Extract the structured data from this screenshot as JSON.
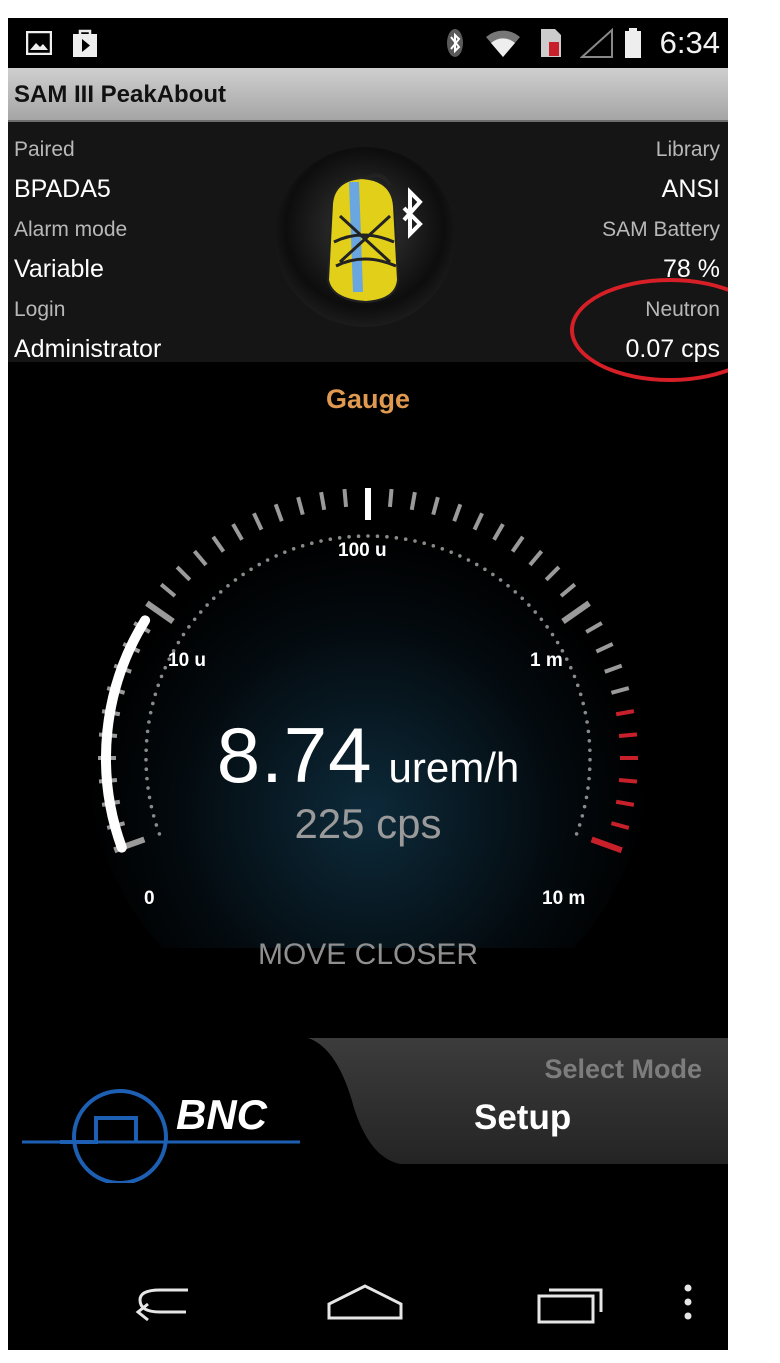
{
  "status_bar": {
    "time": "6:34",
    "icons": [
      "gallery-icon",
      "play-store-icon",
      "bluetooth-icon",
      "wifi-icon",
      "sim-icon",
      "signal-icon",
      "battery-icon"
    ]
  },
  "app": {
    "title": "SAM III PeakAbout"
  },
  "info": {
    "paired_label": "Paired",
    "paired_value": "BPADA5",
    "alarm_label": "Alarm mode",
    "alarm_value": "Variable",
    "login_label": "Login",
    "login_value": "Administrator",
    "library_label": "Library",
    "library_value": "ANSI",
    "battery_label": "SAM Battery",
    "battery_value": "78 %",
    "neutron_label": "Neutron",
    "neutron_value": "0.07 cps"
  },
  "gauge": {
    "title": "Gauge",
    "scale_labels": [
      "0",
      "10 u",
      "100 u",
      "1 m",
      "10 m"
    ],
    "reading_value": "8.74",
    "reading_unit": "urem/h",
    "cps": "225 cps",
    "hint": "MOVE CLOSER",
    "level": 0.235
  },
  "mode": {
    "hint": "Select Mode",
    "name": "Setup"
  },
  "logo": {
    "text": "BNC"
  },
  "colors": {
    "accent_orange": "#e09a50",
    "highlight_red": "#d61f26",
    "logo_blue": "#1d5fb3",
    "danger_red": "#c8202a"
  },
  "nav": {
    "icons": [
      "back-icon",
      "home-icon",
      "recent-apps-icon",
      "overflow-menu-icon"
    ]
  }
}
